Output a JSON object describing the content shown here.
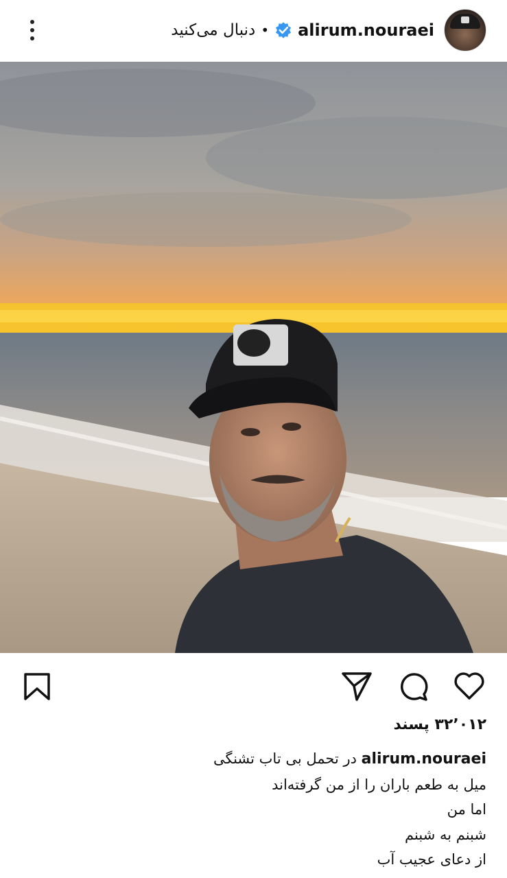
{
  "header": {
    "username": "alirum.nouraei",
    "follow_status": "دنبال می‌کنید",
    "separator": "•",
    "avatar_icon": "avatar",
    "verified_icon": "verified-badge-icon",
    "more_icon": "more-vertical-icon"
  },
  "post": {
    "image_icon": "beach-selfie-photo",
    "likes": "۳۲٬۰۱۲ پسند",
    "caption_user": "alirum.nouraei",
    "caption_lines": [
      "در تحمل بی تاب تشنگی",
      "میل به طعم باران را از من گرفته‌اند",
      "اما من",
      "شبنم به شبنم",
      "از دعای عجیب آب"
    ]
  },
  "actions": {
    "like_icon": "heart-icon",
    "comment_icon": "comment-icon",
    "share_icon": "send-icon",
    "save_icon": "bookmark-icon"
  },
  "colors": {
    "verified": "#3897f0",
    "text": "#111111",
    "sunset": "#f7c52b"
  }
}
